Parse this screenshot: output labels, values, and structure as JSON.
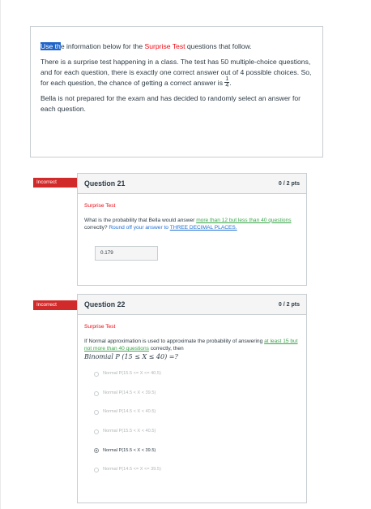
{
  "info": {
    "p1_highlight": "Use th",
    "p1_a": "e information below for the ",
    "p1_red": "Surprise Test",
    "p1_b": " questions that follow.",
    "p2": "There is a surprise test happening in a class. The test has 50 multiple-choice questions, and for each question, there is exactly one correct answer out of 4 possible choices. So, for each question, the chance of getting a correct answer is",
    "p2_num": "1",
    "p2_den": "4",
    "p2_end": ".",
    "p3": "Bella is not prepared for the exam and has decided to randomly select an answer for each question."
  },
  "q21": {
    "tag": "Incorrect",
    "title": "Question 21",
    "points": "0 / 2 pts",
    "section": "Surprise Test",
    "text_a": "What is the probability that Bella would answer ",
    "text_green": "more than 12 but less than 40 questions",
    "text_b": " correctly? ",
    "text_blue": "Round off your answer to ",
    "text_blue_u": "THREE DECIMAL PLACES.",
    "answer": "0.179"
  },
  "q22": {
    "tag": "Incorrect",
    "title": "Question 22",
    "points": "0 / 2 pts",
    "section": "Surprise Test",
    "text_a": "If Normal approximation is used to approximate the probability of answering ",
    "text_green": "at least 15 but not more than 40 questions",
    "text_b": " correctly, then",
    "formula": "Binomial P (15 ≤ X ≤ 40) =?",
    "options": [
      {
        "label": "Normal P(15.5 <= X <= 40.5)",
        "selected": false
      },
      {
        "label": "Normal P(14.5 < X < 39.5)",
        "selected": false
      },
      {
        "label": "Normal P(14.5 < X < 40.5)",
        "selected": false
      },
      {
        "label": "Normal P(15.5 < X < 40.5)",
        "selected": false
      },
      {
        "label": "Normal P(15.5 < X < 39.5)",
        "selected": true
      },
      {
        "label": "Normal P(14.5 <= X <= 39.5)",
        "selected": false
      }
    ]
  },
  "colors": {
    "incorrect_tag": "#d12a2a",
    "section_red": "#ee0612",
    "green_link": "#3aa44a",
    "blue_link": "#2071d6",
    "highlight": "#1f64c8"
  }
}
